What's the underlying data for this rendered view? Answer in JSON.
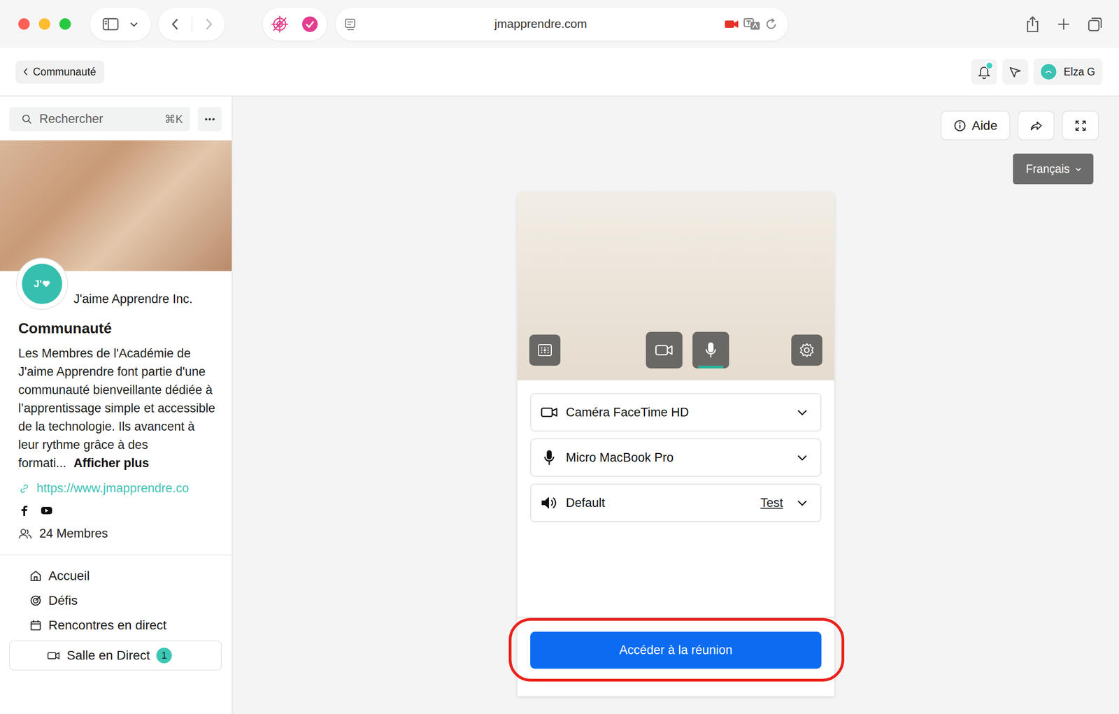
{
  "browser": {
    "url": "jmapprendre.com"
  },
  "header": {
    "back": "Communauté",
    "user": "Elza G",
    "notification": true
  },
  "sidebar": {
    "search": {
      "placeholder": "Rechercher",
      "shortcut": "⌘K"
    },
    "logo": "J'",
    "org": "J'aime Apprendre Inc.",
    "title": "Communauté",
    "description": "Les Membres de l'Académie de J'aime Apprendre font partie d'une communauté bienveillante dédiée à l’apprentissage simple et accessible de la technologie. Ils avancent à leur rythme grâce à des formati...",
    "more": "Afficher plus",
    "link": "https://www.jmapprendre.co",
    "members": "24 Membres",
    "nav": [
      {
        "label": "Accueil",
        "kind": "item",
        "selected": false
      },
      {
        "label": "Défis",
        "kind": "item",
        "selected": false
      },
      {
        "label": "Rencontres en direct",
        "kind": "item",
        "selected": false
      },
      {
        "label": "Salle en Direct",
        "kind": "subitem",
        "selected": true,
        "badge": "1"
      }
    ]
  },
  "main": {
    "help": "Aide",
    "language": "Français",
    "preview": {
      "camera_on": true,
      "mic_on": true
    },
    "devices": [
      {
        "kind": "camera",
        "label": "Caméra FaceTime HD"
      },
      {
        "kind": "mic",
        "label": "Micro MacBook Pro"
      },
      {
        "kind": "speaker",
        "label": "Default",
        "action": "Test"
      }
    ],
    "join": "Accéder à la réunion",
    "join_highlighted": true
  }
}
